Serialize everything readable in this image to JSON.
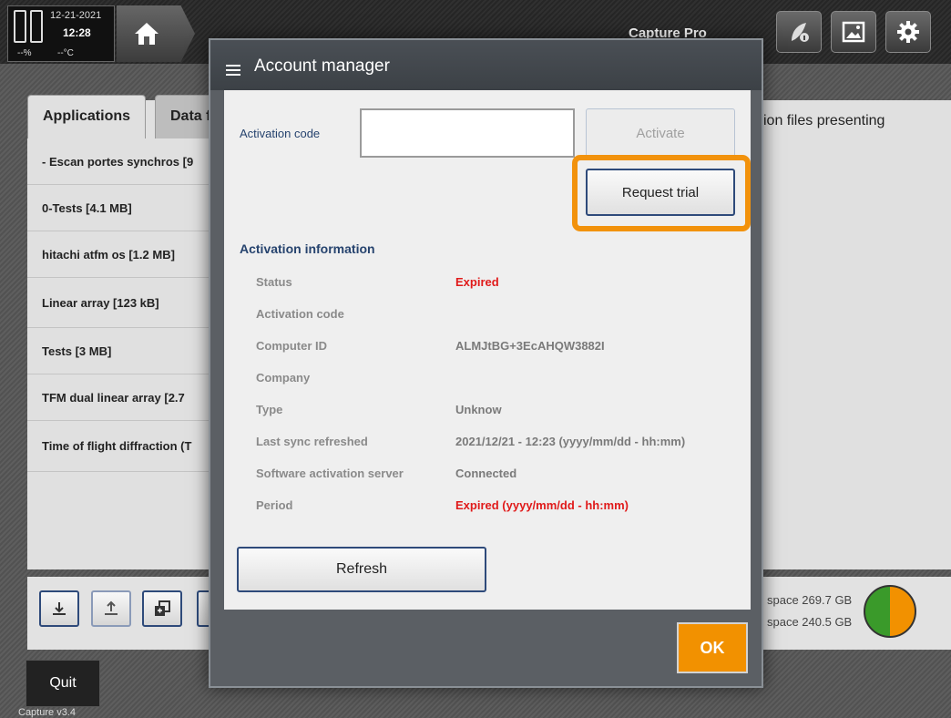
{
  "status": {
    "date": "12-21-2021",
    "time": "12:28",
    "battery_pct": "--%",
    "temperature": "--°C"
  },
  "header": {
    "app_title": "Capture Pro"
  },
  "toolbar": {
    "icons": [
      "user-info-icon",
      "image-icon",
      "gear-icon"
    ]
  },
  "main": {
    "tabs": [
      {
        "label": "Applications",
        "active": true
      },
      {
        "label": "Data f",
        "active": false
      }
    ],
    "applications": [
      "- Escan portes synchros [9",
      "0-Tests [4.1  MB]",
      "hitachi atfm os [1.2  MB]",
      "Linear array [123  kB]",
      "Tests [3  MB]",
      "TFM dual linear array [2.7",
      "Time of flight diffraction (T"
    ],
    "right_text": "ion files presenting"
  },
  "bottom": {
    "space_line_1": "space 269.7  GB",
    "space_line_2": "space 240.5  GB",
    "buttons": [
      "download-icon",
      "upload-icon",
      "copy-icon"
    ]
  },
  "quit_label": "Quit",
  "version": "Capture v3.4",
  "dialog": {
    "title": "Account manager",
    "activation_code_label": "Activation code",
    "activation_code_value": "",
    "activate_label": "Activate",
    "request_trial_label": "Request trial",
    "info_heading": "Activation information",
    "info_rows": [
      {
        "key": "Status",
        "value": "Expired",
        "highlight": true
      },
      {
        "key": "Activation code",
        "value": "",
        "highlight": false
      },
      {
        "key": "Computer ID",
        "value": "ALMJtBG+3EcAHQW3882I",
        "highlight": false
      },
      {
        "key": "Company",
        "value": "",
        "highlight": false
      },
      {
        "key": "Type",
        "value": "Unknow",
        "highlight": false
      },
      {
        "key": "Last sync refreshed",
        "value": "2021/12/21 - 12:23 (yyyy/mm/dd - hh:mm)",
        "highlight": false
      },
      {
        "key": "Software activation server",
        "value": "Connected",
        "highlight": false
      },
      {
        "key": "Period",
        "value": "Expired (yyyy/mm/dd - hh:mm)",
        "highlight": true
      }
    ],
    "refresh_label": "Refresh",
    "ok_label": "OK"
  },
  "colors": {
    "accent_orange": "#f29100",
    "expired_red": "#e01a1a",
    "label_blue": "#26436e"
  }
}
